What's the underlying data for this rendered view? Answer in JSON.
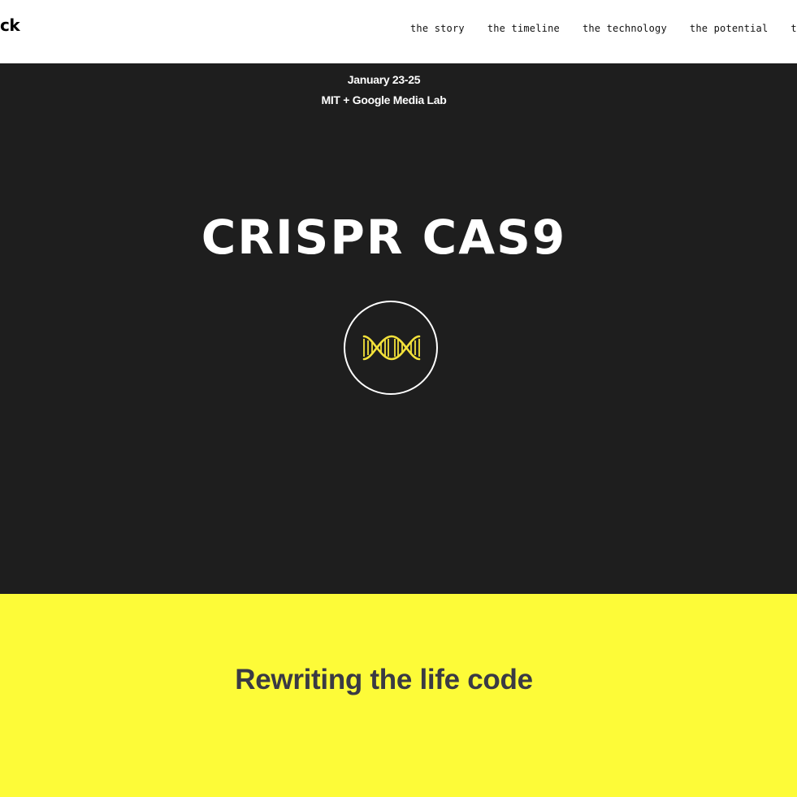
{
  "header": {
    "brand": "ck",
    "nav": [
      {
        "label": "the story"
      },
      {
        "label": "the timeline"
      },
      {
        "label": "the technology"
      },
      {
        "label": "the potential"
      },
      {
        "label": "th"
      }
    ]
  },
  "hero": {
    "date": "January 23-25",
    "venue": "MIT + Google Media Lab",
    "title": "CRISPR CAS9",
    "icon": "dna-icon"
  },
  "tagline": {
    "text": "Rewriting the life code"
  },
  "colors": {
    "hero_bg": "#1e1e1e",
    "accent_yellow": "#fdfb38",
    "dna_yellow": "#f4e23a",
    "tagline_text": "#3a3a44"
  }
}
